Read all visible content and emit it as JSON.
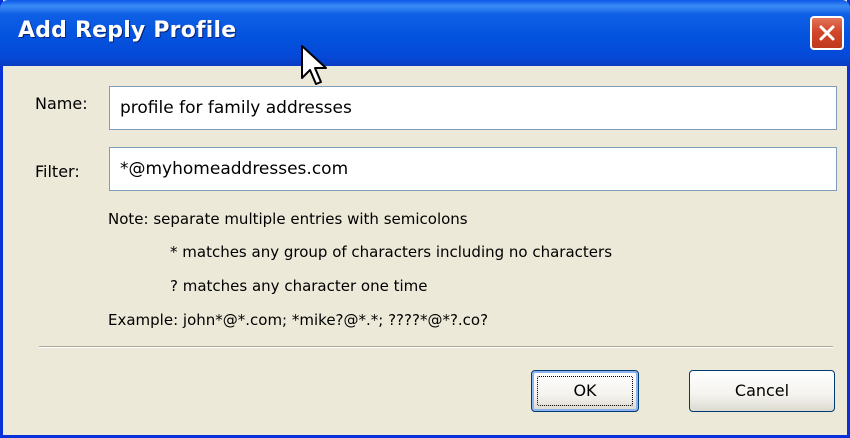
{
  "window": {
    "title": "Add Reply Profile",
    "close_icon": "close-icon"
  },
  "form": {
    "name_label": "Name:",
    "name_value": "profile for family addresses",
    "filter_label": "Filter:",
    "filter_value": "*@myhomeaddresses.com"
  },
  "notes": {
    "line1": "Note: separate multiple entries with semicolons",
    "line2": "* matches any group of characters including no characters",
    "line3": "? matches any character one time",
    "example": "Example: john*@*.com; *mike?@*.*; ????*@*?.co?"
  },
  "buttons": {
    "ok_label": "OK",
    "cancel_label": "Cancel"
  },
  "colors": {
    "titlebar": "#0453de",
    "close": "#d2462a",
    "dialog_bg": "#ece9d8"
  },
  "icons": {
    "cursor": "mouse-pointer-icon"
  }
}
